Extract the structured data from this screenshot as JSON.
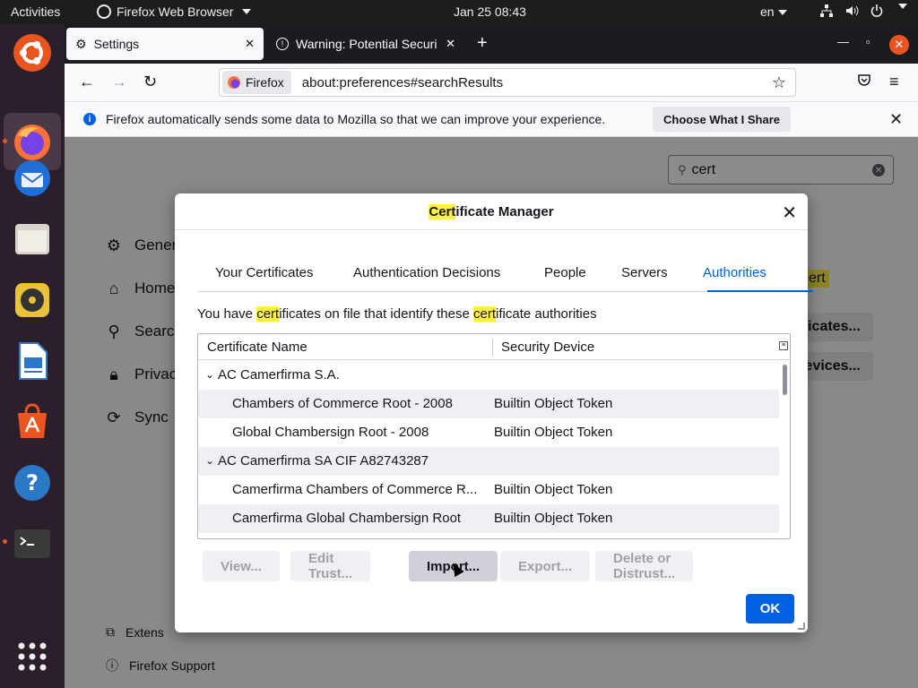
{
  "topbar": {
    "activities": "Activities",
    "app_name": "Firefox Web Browser",
    "clock": "Jan 25  08:43",
    "lang": "en"
  },
  "dock": {
    "items": [
      "ubuntu-icon",
      "firefox-icon",
      "thunderbird-icon",
      "files-icon",
      "rhythmbox-icon",
      "libreoffice-writer-icon",
      "app-center-icon",
      "help-icon",
      "terminal-icon",
      "app-grid-icon"
    ]
  },
  "browser": {
    "tabs": [
      {
        "label": "Settings"
      },
      {
        "label": "Warning: Potential Securi"
      }
    ],
    "url_identity": "Firefox",
    "url": "about:preferences#searchResults",
    "infobar": {
      "message": "Firefox automatically sends some data to Mozilla so that we can improve your experience.",
      "button": "Choose What I Share"
    }
  },
  "prefs": {
    "search_value": "cert",
    "categories": [
      {
        "label": "Gener",
        "icon": "gear-icon"
      },
      {
        "label": "Home",
        "icon": "home-icon"
      },
      {
        "label": "Search",
        "icon": "search-icon"
      },
      {
        "label": "Privac",
        "icon": "lock-icon"
      },
      {
        "label": "Sync",
        "icon": "sync-icon"
      }
    ],
    "bg_highlight": "ert",
    "bg_buttons": [
      "tificates...",
      "Devices..."
    ],
    "footer": [
      {
        "label": "Extens",
        "icon": "extension-icon"
      },
      {
        "label": "Firefox Support",
        "icon": "help-circle-icon"
      }
    ]
  },
  "dialog": {
    "title_hl": "Cert",
    "title_rest": "ificate Manager",
    "tabs": [
      "Your Certificates",
      "Authentication Decisions",
      "People",
      "Servers",
      "Authorities"
    ],
    "selected_tab": "Authorities",
    "desc": {
      "p1": "You have ",
      "hl1": "cert",
      "p2": "ificates on file that identify these ",
      "hl2": "cert",
      "p3": "ificate authorities"
    },
    "columns": [
      "Certificate Name",
      "Security Device"
    ],
    "rows": [
      {
        "name": "AC Camerfirma S.A.",
        "device": "",
        "group": true
      },
      {
        "name": "Chambers of Commerce Root - 2008",
        "device": "Builtin Object Token",
        "group": false
      },
      {
        "name": "Global Chambersign Root - 2008",
        "device": "Builtin Object Token",
        "group": false
      },
      {
        "name": "AC Camerfirma SA CIF A82743287",
        "device": "",
        "group": true
      },
      {
        "name": "Camerfirma Chambers of Commerce R...",
        "device": "Builtin Object Token",
        "group": false
      },
      {
        "name": "Camerfirma Global Chambersign Root",
        "device": "Builtin Object Token",
        "group": false
      }
    ],
    "buttons": [
      "View...",
      "Edit Trust...",
      "Import...",
      "Export...",
      "Delete or Distrust..."
    ],
    "ok": "OK"
  }
}
